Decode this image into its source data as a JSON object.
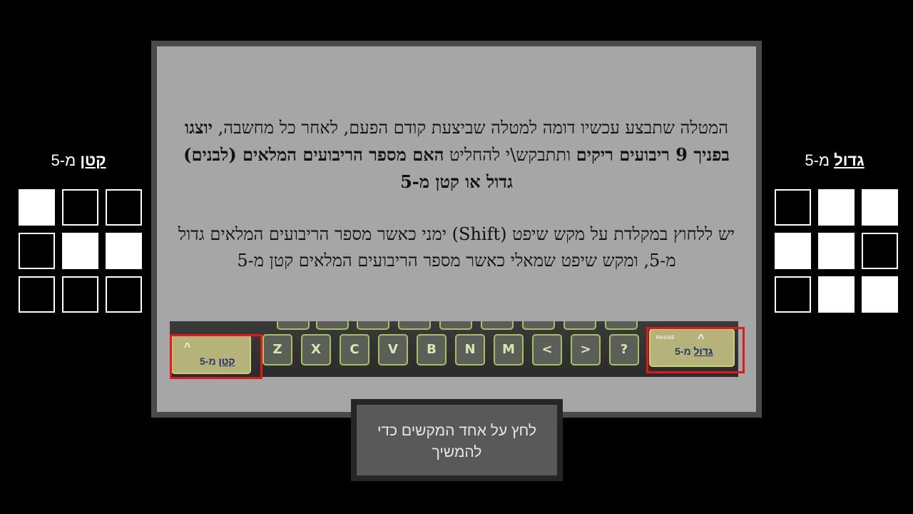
{
  "left_option": {
    "label_bold": "קטן",
    "label_rest": " מ-5",
    "grid": [
      true,
      false,
      false,
      false,
      true,
      true,
      false,
      false,
      false
    ]
  },
  "right_option": {
    "label_bold": "גדול",
    "label_rest": " מ-5",
    "grid": [
      false,
      true,
      true,
      true,
      true,
      false,
      false,
      true,
      true
    ]
  },
  "instructions": {
    "p1_a": "המטלה שתבצע עכשיו דומה למטלה שביצעת קודם הפעם, לאחר כל מחשבה, ",
    "p1_b": "יוצגו בפניך 9 ריבועים ריקים",
    "p1_c": " ותתבקש\\י להחליט ",
    "p1_d": "האם מספר הריבועים המלאים (לבנים) גדול או קטן מ-5",
    "p2": "יש ללחוץ במקלדת על מקש שיפט (Shift) ימני כאשר מספר הריבועים המלאים גדול מ-5, ומקש שיפט שמאלי כאשר מספר הריבועים המלאים קטן מ-5"
  },
  "keyboard": {
    "keys": [
      "Z",
      "X",
      "C",
      "V",
      "B",
      "N",
      "M",
      "<",
      ">",
      "?"
    ],
    "left_key": {
      "label_bold": "קטן",
      "label_rest": " מ-5",
      "caret": "^"
    },
    "right_key": {
      "label_bold": "גדול",
      "label_rest": " מ-5",
      "caret": "^",
      "small": "PAUSE"
    }
  },
  "continue_button": {
    "label": "לחץ על אחד המקשים כדי להמשיך"
  }
}
